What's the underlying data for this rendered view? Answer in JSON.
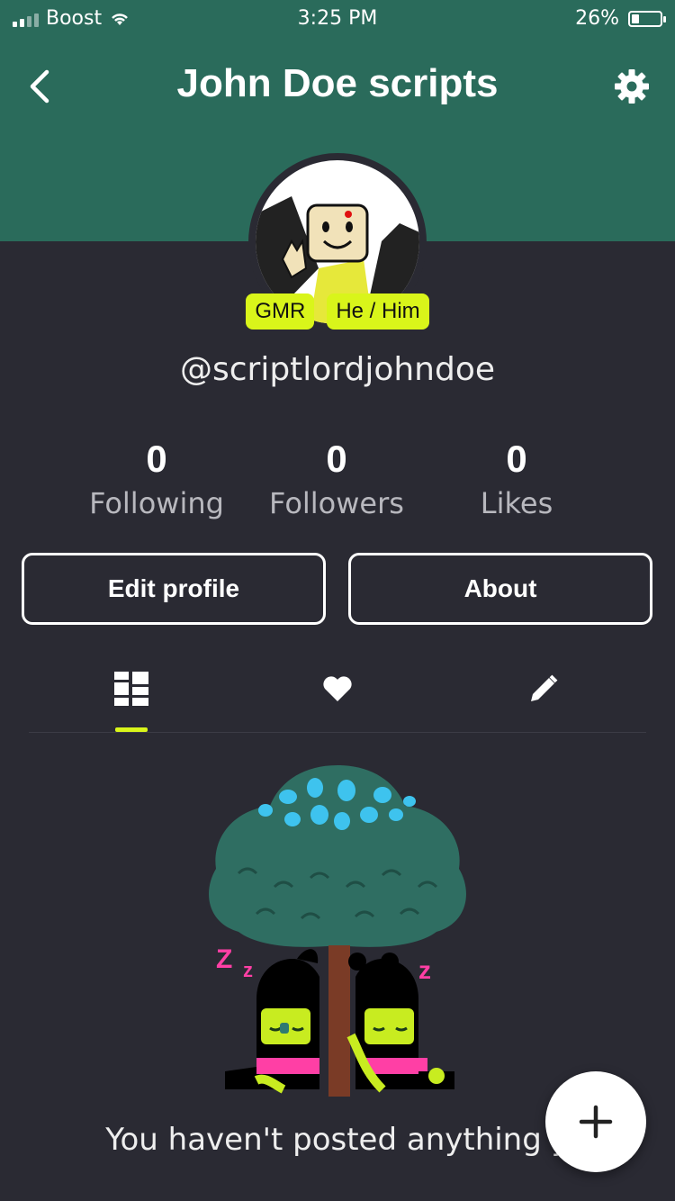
{
  "status_bar": {
    "carrier": "Boost",
    "time": "3:25 PM",
    "battery": "26%"
  },
  "header": {
    "title": "John Doe scripts",
    "back_icon": "chevron-left-icon",
    "settings_icon": "gear-icon"
  },
  "profile": {
    "badges": [
      "GMR",
      "He / Him"
    ],
    "username": "@scriptlordjohndoe",
    "stats": [
      {
        "value": "0",
        "label": "Following"
      },
      {
        "value": "0",
        "label": "Followers"
      },
      {
        "value": "0",
        "label": "Likes"
      }
    ],
    "buttons": {
      "edit": "Edit profile",
      "about": "About"
    }
  },
  "tabs": [
    {
      "icon": "grid-icon",
      "active": true
    },
    {
      "icon": "heart-icon",
      "active": false
    },
    {
      "icon": "pencil-icon",
      "active": false
    }
  ],
  "empty_state": {
    "message": "You haven't posted anything y"
  },
  "fab": {
    "icon": "plus-icon"
  },
  "colors": {
    "header": "#2a6b5b",
    "background": "#2a2a33",
    "accent": "#d9f51a"
  }
}
